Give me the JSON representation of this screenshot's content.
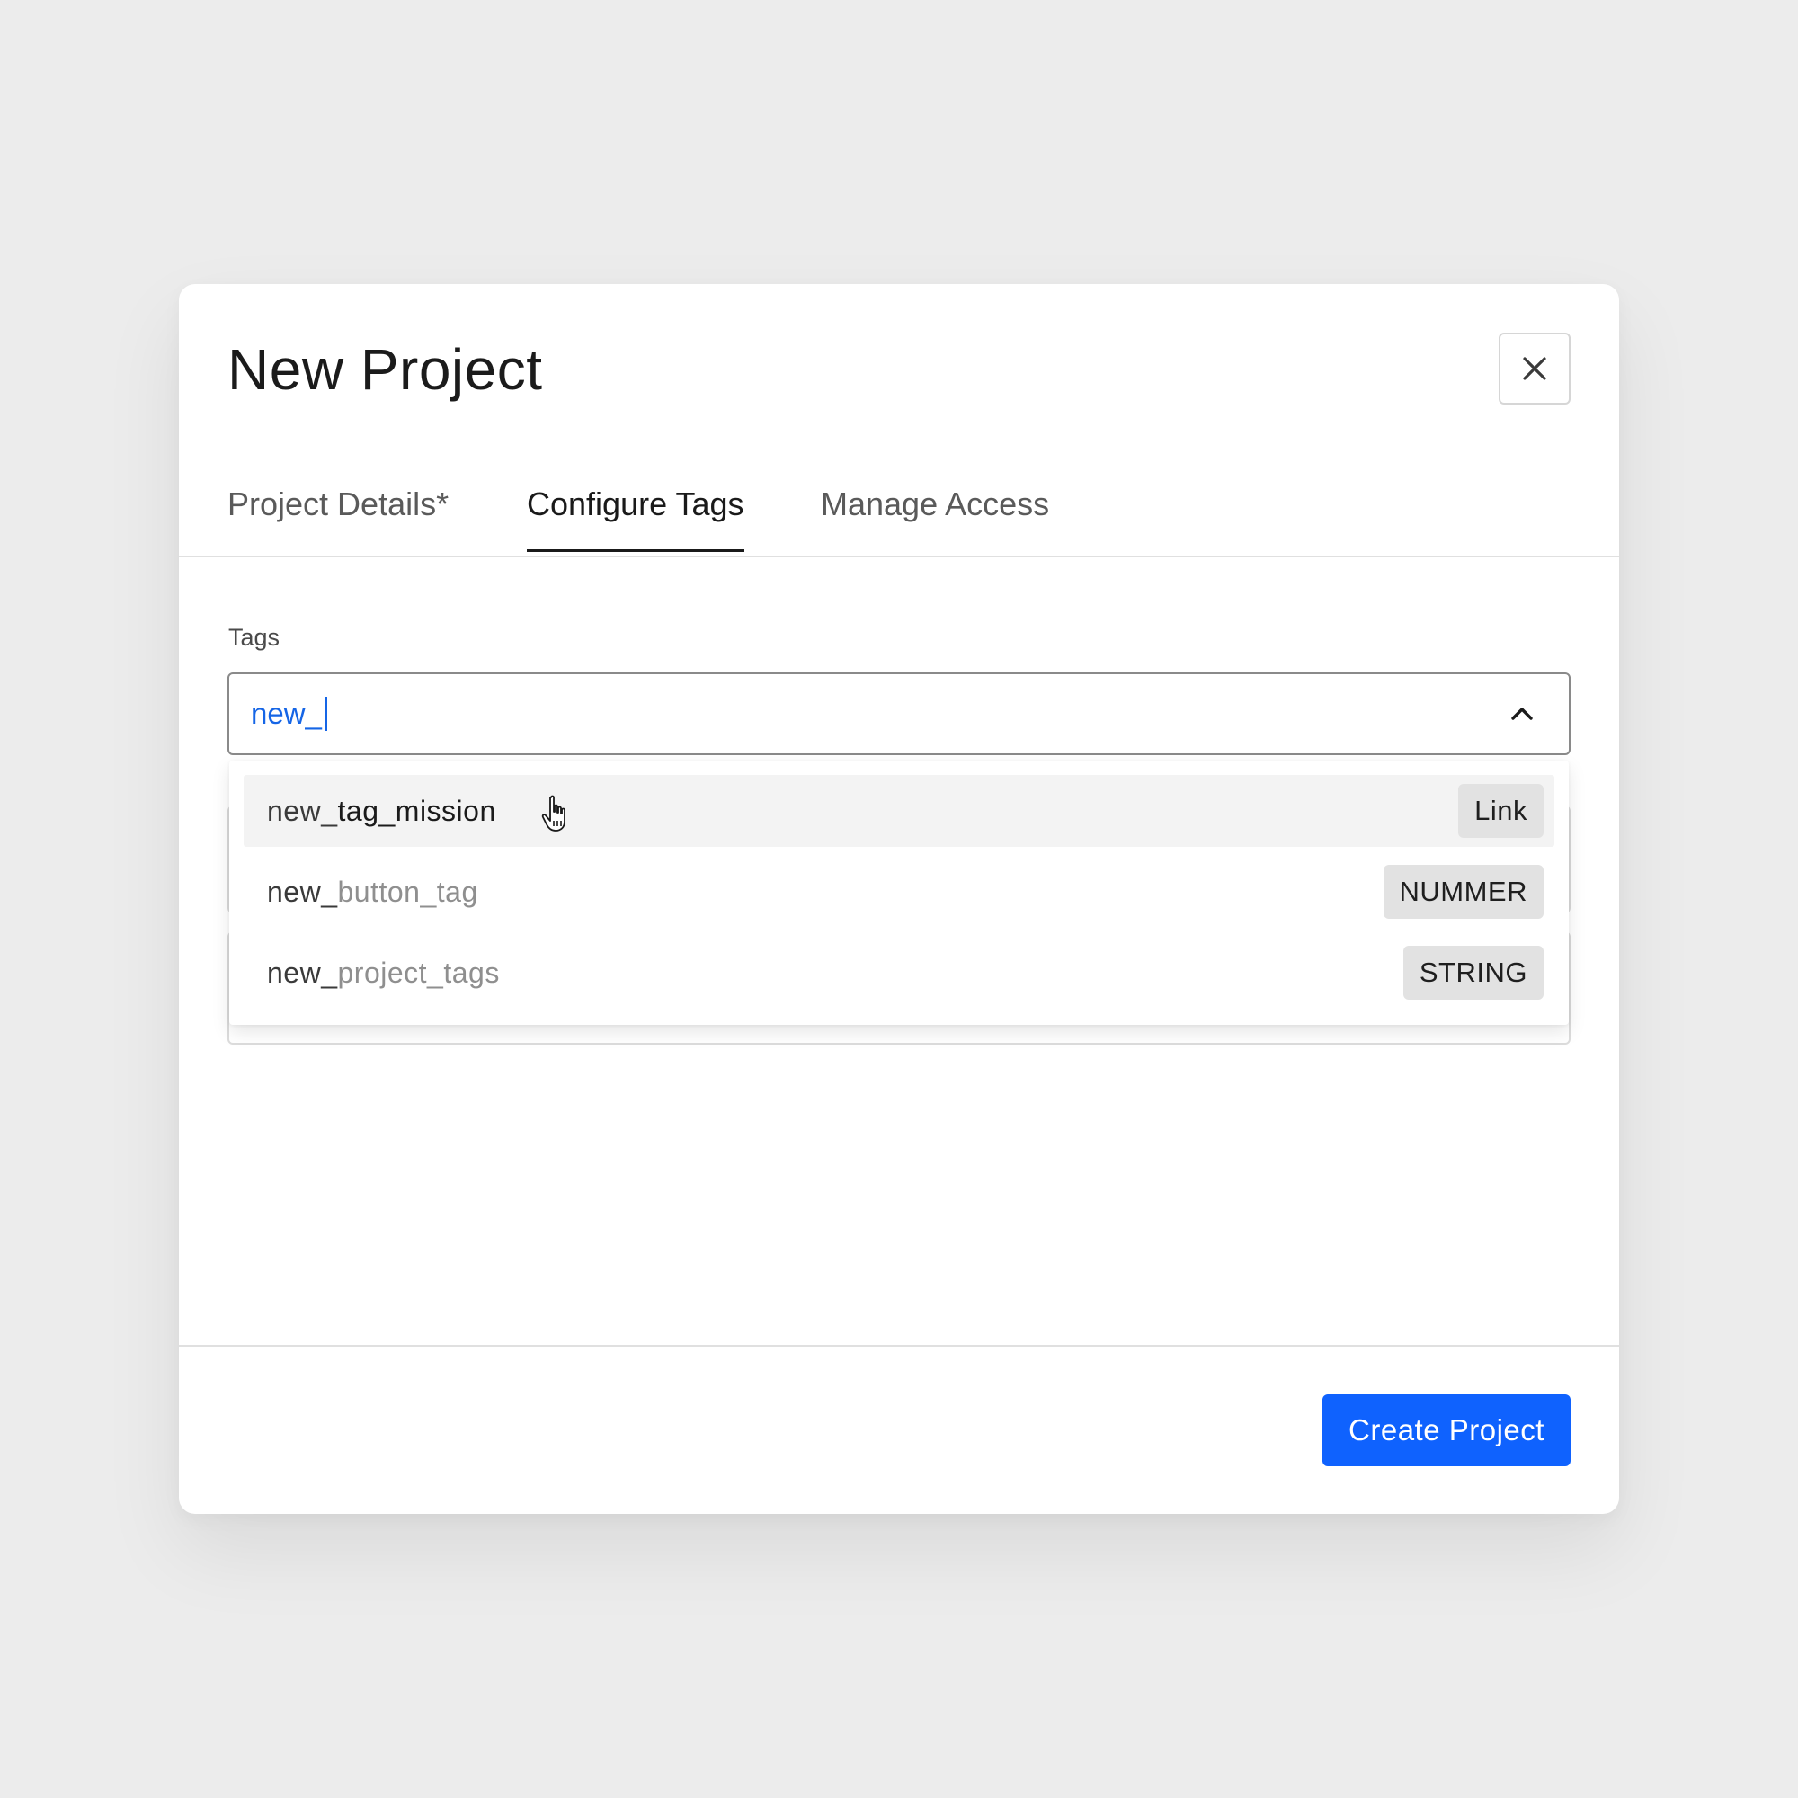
{
  "modal": {
    "title": "New Project",
    "close_icon": "close-icon"
  },
  "tabs": [
    {
      "label": "Project Details*",
      "active": false
    },
    {
      "label": "Configure Tags",
      "active": true
    },
    {
      "label": "Manage Access",
      "active": false
    }
  ],
  "tags_field": {
    "label": "Tags",
    "value": "new_",
    "toggle_icon": "chevron-up-icon"
  },
  "dropdown": {
    "options": [
      {
        "match": "new_",
        "rest": "tag_mission",
        "type": "Link",
        "highlighted": true
      },
      {
        "match": "new_",
        "rest": "button_tag",
        "type": "NUMMER",
        "highlighted": false
      },
      {
        "match": "new_",
        "rest": "project_tags",
        "type": "STRING",
        "highlighted": false
      }
    ]
  },
  "footer": {
    "create_label": "Create Project"
  },
  "colors": {
    "accent": "#0f62fe",
    "input_text": "#1565e6",
    "background": "#ececec"
  },
  "pointer_icon": "hand-pointer-icon"
}
